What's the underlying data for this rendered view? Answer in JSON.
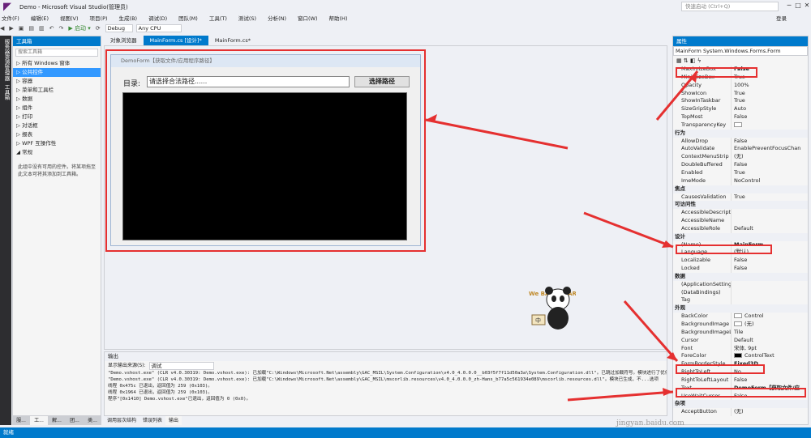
{
  "title_bar": {
    "title": "Demo - Microsoft Visual Studio(管理员)",
    "quick_launch": "快速启动 (Ctrl+Q)"
  },
  "menu": [
    "文件(F)",
    "编辑(E)",
    "视图(V)",
    "项目(P)",
    "生成(B)",
    "调试(D)",
    "团队(M)",
    "工具(T)",
    "测试(S)",
    "分析(N)",
    "窗口(W)",
    "帮助(H)"
  ],
  "signin": "登录",
  "toolbar": {
    "start_label": "▶ 启动 ▾",
    "config": "Debug",
    "platform": "Any CPU"
  },
  "left_strip": [
    "服务器资源管理器",
    "工具箱"
  ],
  "toolbox": {
    "title": "工具箱",
    "search_placeholder": "搜索工具箱",
    "items": [
      "▷ 所有 Windows 窗体",
      "▷ 公共控件",
      "▷ 容器",
      "▷ 菜单和工具栏",
      "▷ 数据",
      "▷ 组件",
      "▷ 打印",
      "▷ 对话框",
      "▷ 报表",
      "▷ WPF 互操作性",
      "◢ 常规"
    ],
    "note": "此组中没有可用的控件。将某项拖至此文本可将其添加到工具箱。",
    "bottom_tabs": [
      "服...",
      "工...",
      "解...",
      "团...",
      "类..."
    ]
  },
  "doc_tabs": [
    "对象浏览器",
    "MainForm.cs [设计]*",
    "MainForm.cs*"
  ],
  "form": {
    "title": "DemoForm【获取文件/应用程序路径】",
    "label": "目录:",
    "path_value": "请选择合法路径......",
    "button": "选择路径"
  },
  "output": {
    "title": "输出",
    "source_label": "显示输出来源(S):",
    "source_value": "调试",
    "lines": [
      "\"Demo.vshost.exe\" (CLR v4.0.30319: Demo.vshost.exe): 已加载\"C:\\Windows\\Microsoft.Net\\assembly\\GAC_MSIL\\System.Configuration\\v4.0_4.0.0.0__b03f5f7f11d50a3a\\System.Configuration.dll\"。已跳过加载符号。模块进行了优化...",
      "\"Demo.vshost.exe\" (CLR v4.0.30319: Demo.vshost.exe): 已加载\"C:\\Windows\\Microsoft.Net\\assembly\\GAC_MSIL\\mscorlib.resources\\v4.0_4.0.0.0_zh-Hans_b77a5c561934e089\\mscorlib.resources.dll\"。模块已生成，不...选项",
      "线程 0x475c 已退出，返回值为 259 (0x103)。",
      "线程 0x1964 已退出，返回值为 259 (0x103)。",
      "程序\"[0x1410] Demo.vshost.exe\"已退出，返回值为 0 (0x0)。"
    ],
    "tabs": [
      "调用层次结构",
      "错误列表",
      "输出"
    ]
  },
  "properties": {
    "title": "属性",
    "selector": "MainForm System.Windows.Forms.Form",
    "rows": [
      {
        "n": "MaximizeBox",
        "v": "False",
        "b": true
      },
      {
        "n": "MinimizeBox",
        "v": "True"
      },
      {
        "n": "Opacity",
        "v": "100%"
      },
      {
        "n": "ShowIcon",
        "v": "True"
      },
      {
        "n": "ShowInTaskbar",
        "v": "True"
      },
      {
        "n": "SizeGripStyle",
        "v": "Auto"
      },
      {
        "n": "TopMost",
        "v": "False"
      },
      {
        "n": "TransparencyKey",
        "v": ""
      },
      {
        "cat": "行为"
      },
      {
        "n": "AllowDrop",
        "v": "False"
      },
      {
        "n": "AutoValidate",
        "v": "EnablePreventFocusChan"
      },
      {
        "n": "ContextMenuStrip",
        "v": "(无)"
      },
      {
        "n": "DoubleBuffered",
        "v": "False"
      },
      {
        "n": "Enabled",
        "v": "True"
      },
      {
        "n": "ImeMode",
        "v": "NoControl"
      },
      {
        "cat": "焦点"
      },
      {
        "n": "CausesValidation",
        "v": "True"
      },
      {
        "cat": "可访问性"
      },
      {
        "n": "AccessibleDescription",
        "v": ""
      },
      {
        "n": "AccessibleName",
        "v": ""
      },
      {
        "n": "AccessibleRole",
        "v": "Default"
      },
      {
        "cat": "设计"
      },
      {
        "n": "(Name)",
        "v": "MainForm",
        "b": true
      },
      {
        "n": "Language",
        "v": "(默认)"
      },
      {
        "n": "Localizable",
        "v": "False"
      },
      {
        "n": "Locked",
        "v": "False"
      },
      {
        "cat": "数据"
      },
      {
        "n": "(ApplicationSettings)",
        "v": ""
      },
      {
        "n": "(DataBindings)",
        "v": ""
      },
      {
        "n": "Tag",
        "v": ""
      },
      {
        "cat": "外观"
      },
      {
        "n": "BackColor",
        "v": "Control"
      },
      {
        "n": "BackgroundImage",
        "v": "(无)"
      },
      {
        "n": "BackgroundImageLayo",
        "v": "Tile"
      },
      {
        "n": "Cursor",
        "v": "Default"
      },
      {
        "n": "Font",
        "v": "宋体, 9pt"
      },
      {
        "n": "ForeColor",
        "v": "ControlText"
      },
      {
        "n": "FormBorderStyle",
        "v": "Fixed3D",
        "b": true
      },
      {
        "n": "RightToLeft",
        "v": "No"
      },
      {
        "n": "RightToLeftLayout",
        "v": "False"
      },
      {
        "n": "Text",
        "v": "DemoForm【获取文件/应",
        "b": true
      },
      {
        "n": "UseWaitCursor",
        "v": "False"
      },
      {
        "cat": "杂项"
      },
      {
        "n": "AcceptButton",
        "v": "(无)"
      }
    ]
  },
  "status": "就绪",
  "watermark": "jingyan.baidu.com",
  "mascot": {
    "title": "We BARE BEARS",
    "sign": "中"
  }
}
